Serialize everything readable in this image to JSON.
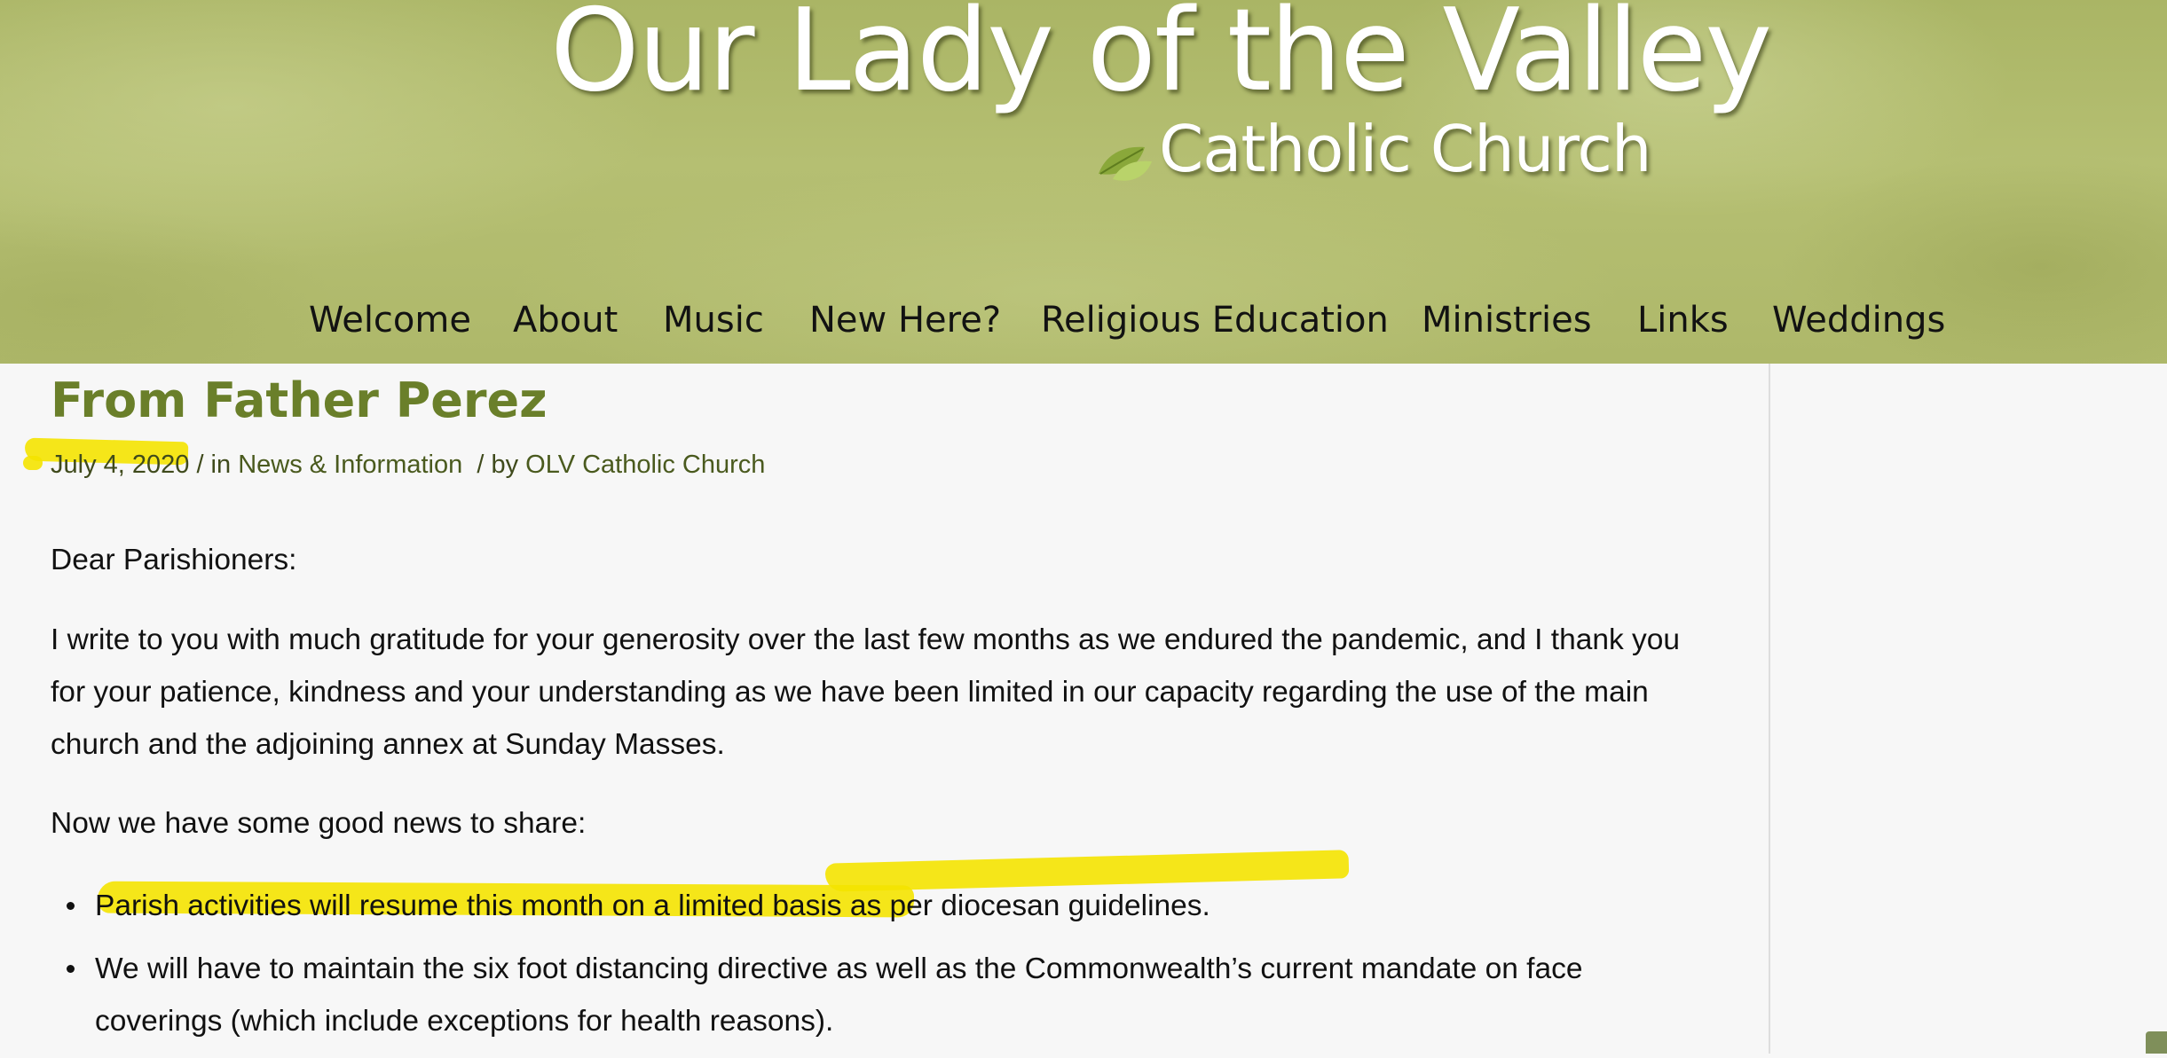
{
  "header": {
    "logo_title": "Our Lady of the Valley",
    "logo_subtitle": "Catholic Church",
    "logo_icon": "leaf-icon"
  },
  "nav": {
    "items": [
      {
        "label": "Welcome"
      },
      {
        "label": "About"
      },
      {
        "label": "Music"
      },
      {
        "label": "New Here?"
      },
      {
        "label": "Religious Education"
      },
      {
        "label": "Ministries"
      },
      {
        "label": "Links"
      },
      {
        "label": "Weddings"
      }
    ]
  },
  "post": {
    "title": "From Father Perez",
    "date": "July 4, 2020",
    "meta_in": " / in ",
    "category": "News & Information",
    "meta_by": "  / by ",
    "author": "OLV Catholic Church",
    "greeting": "Dear Parishioners:",
    "paragraph_1": "I write to you with much gratitude for your generosity over the last few months as we endured the pandemic, and I thank you for your patience, kindness and your understanding as we have been limited in our capacity regarding the use of the main church and the adjoining annex at Sunday Masses.",
    "paragraph_2": "Now we have some good news to share:",
    "bullets": [
      "Parish activities will resume this month on a limited basis as per diocesan guidelines.",
      "We will have to maintain the six foot distancing directive as well as the Commonwealth’s current mandate on face coverings (which include exceptions for health reasons)."
    ]
  },
  "colors": {
    "header_green": "#b0ba6c",
    "title_green": "#6a7f2a",
    "highlighter": "#f4e300",
    "scroll_button": "#7f8f5a"
  }
}
